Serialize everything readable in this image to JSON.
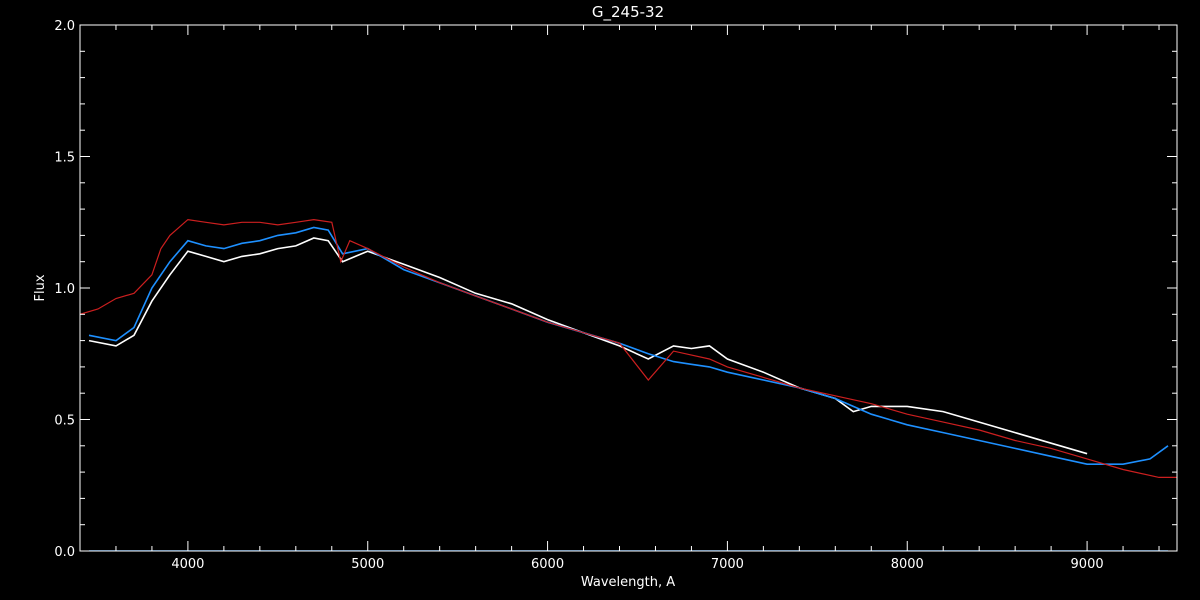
{
  "chart_data": {
    "type": "line",
    "title": "G_245-32",
    "xlabel": "Wavelength, A",
    "ylabel": "Flux",
    "xlim": [
      3400,
      9500
    ],
    "ylim": [
      0.0,
      2.0
    ],
    "xticks": [
      4000,
      5000,
      6000,
      7000,
      8000,
      9000
    ],
    "xtick_labels": [
      "4000",
      "5000",
      "6000",
      "7000",
      "8000",
      "9000"
    ],
    "yticks": [
      0.0,
      0.5,
      1.0,
      1.5,
      2.0
    ],
    "ytick_labels": [
      "0.0",
      "0.5",
      "1.0",
      "1.5",
      "2.0"
    ],
    "grid": false,
    "colors": {
      "background": "#000000",
      "axes": "#ffffff",
      "white_series": "#ffffff",
      "blue_series": "#1e90ff",
      "red_series": "#cc1f1f"
    },
    "series": [
      {
        "color": "#ffffff",
        "x": [
          3450,
          3600,
          3700,
          3800,
          3900,
          4000,
          4100,
          4200,
          4300,
          4400,
          4500,
          4600,
          4700,
          4780,
          4860,
          5000,
          5200,
          5400,
          5600,
          5800,
          6000,
          6200,
          6400,
          6560,
          6700,
          6800,
          6900,
          7000,
          7200,
          7400,
          7600,
          7700,
          7800,
          8000,
          8200,
          8400,
          8600,
          8800,
          9000
        ],
        "y": [
          0.8,
          0.78,
          0.82,
          0.95,
          1.05,
          1.14,
          1.12,
          1.1,
          1.12,
          1.13,
          1.15,
          1.16,
          1.19,
          1.18,
          1.1,
          1.14,
          1.09,
          1.04,
          0.98,
          0.94,
          0.88,
          0.83,
          0.78,
          0.73,
          0.78,
          0.77,
          0.78,
          0.73,
          0.68,
          0.62,
          0.58,
          0.53,
          0.55,
          0.55,
          0.53,
          0.49,
          0.45,
          0.41,
          0.37
        ]
      },
      {
        "color": "#1e90ff",
        "x": [
          3450,
          3600,
          3700,
          3800,
          3900,
          4000,
          4100,
          4200,
          4300,
          4400,
          4500,
          4600,
          4700,
          4780,
          4860,
          5000,
          5200,
          5400,
          5600,
          5800,
          6000,
          6200,
          6400,
          6560,
          6700,
          6800,
          6900,
          7000,
          7200,
          7400,
          7600,
          7700,
          7800,
          8000,
          8200,
          8400,
          8600,
          8800,
          9000,
          9200,
          9350,
          9450
        ],
        "y": [
          0.82,
          0.8,
          0.85,
          1.0,
          1.1,
          1.18,
          1.16,
          1.15,
          1.17,
          1.18,
          1.2,
          1.21,
          1.23,
          1.22,
          1.13,
          1.15,
          1.07,
          1.02,
          0.97,
          0.92,
          0.87,
          0.83,
          0.79,
          0.75,
          0.72,
          0.71,
          0.7,
          0.68,
          0.65,
          0.62,
          0.58,
          0.55,
          0.52,
          0.48,
          0.45,
          0.42,
          0.39,
          0.36,
          0.33,
          0.33,
          0.35,
          0.4
        ]
      },
      {
        "color": "#1e90ff",
        "x": [
          3450,
          9450
        ],
        "y": [
          0.0,
          0.0
        ]
      },
      {
        "color": "#cc1f1f",
        "x": [
          3400,
          3500,
          3600,
          3700,
          3800,
          3850,
          3900,
          4000,
          4100,
          4200,
          4300,
          4400,
          4500,
          4600,
          4700,
          4800,
          4850,
          4900,
          5000,
          5200,
          5400,
          5600,
          5800,
          6000,
          6200,
          6400,
          6560,
          6700,
          6900,
          7000,
          7200,
          7400,
          7600,
          7800,
          8000,
          8200,
          8400,
          8600,
          8800,
          9000,
          9200,
          9400,
          9500
        ],
        "y": [
          0.9,
          0.92,
          0.96,
          0.98,
          1.05,
          1.15,
          1.2,
          1.26,
          1.25,
          1.24,
          1.25,
          1.25,
          1.24,
          1.25,
          1.26,
          1.25,
          1.1,
          1.18,
          1.15,
          1.08,
          1.02,
          0.97,
          0.92,
          0.87,
          0.83,
          0.79,
          0.65,
          0.76,
          0.73,
          0.7,
          0.66,
          0.62,
          0.59,
          0.56,
          0.52,
          0.49,
          0.46,
          0.42,
          0.39,
          0.35,
          0.31,
          0.28,
          0.28
        ]
      }
    ]
  }
}
